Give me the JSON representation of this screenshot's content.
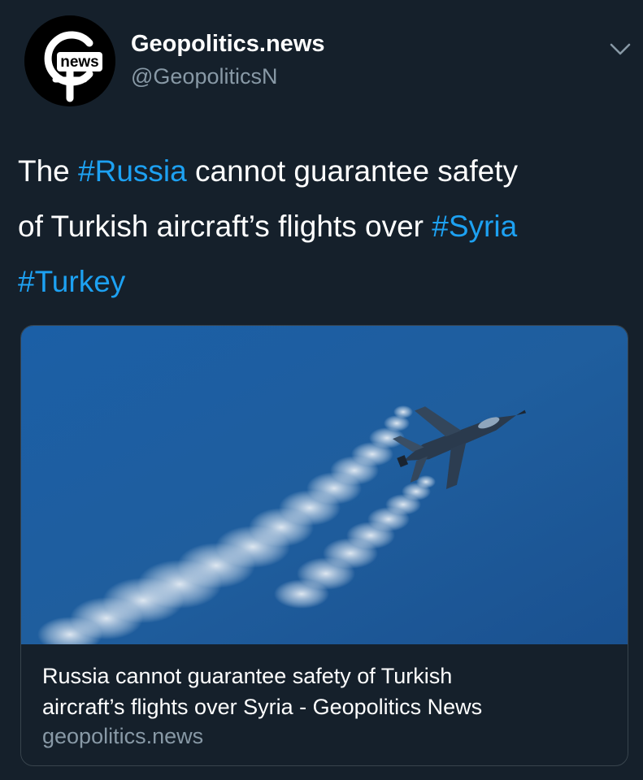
{
  "colors": {
    "background": "#15202b",
    "text_primary": "#ffffff",
    "text_secondary": "#8899a6",
    "hashtag": "#1da1f2",
    "card_border": "#38444d",
    "sky": "#1d5b9c"
  },
  "author": {
    "avatar_label": "news",
    "display_name": "Geopolitics.news",
    "handle": "@GeopoliticsN",
    "menu_icon": "chevron-down-icon"
  },
  "tweet": {
    "line1": {
      "text_a": "The ",
      "tag_1": "#Russia",
      "text_b": " cannot guarantee safety"
    },
    "line2": {
      "text_a": "of Turkish aircraft’s flights over ",
      "tag_2": "#Syria"
    },
    "line3": {
      "tag_3": "#Turkey"
    }
  },
  "card": {
    "image_description_icon": "fighter-jet-image",
    "title_line1": "Russia cannot guarantee safety of Turkish",
    "title_line2": "aircraft’s flights over Syria - Geopolitics News",
    "domain": "geopolitics.news"
  }
}
